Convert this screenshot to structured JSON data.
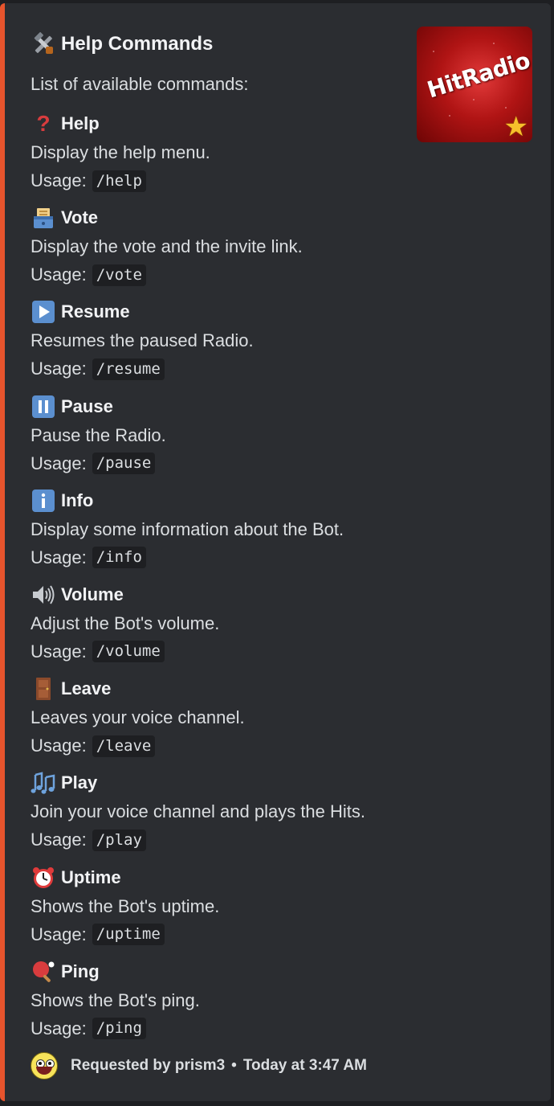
{
  "embed": {
    "accent_color": "#e7542d",
    "title_icon": "hammer-and-wrench-icon",
    "title": "Help Commands",
    "description": "List of available commands:",
    "thumbnail": {
      "text": "HitRadio",
      "icon": "star-icon"
    },
    "usage_label": "Usage:",
    "fields": [
      {
        "icon": "question-mark-icon",
        "name": "Help",
        "description": "Display the help menu.",
        "command": "/help"
      },
      {
        "icon": "ballot-box-icon",
        "name": "Vote",
        "description": "Display the vote and the invite link.",
        "command": "/vote"
      },
      {
        "icon": "play-button-icon",
        "name": "Resume",
        "description": "Resumes the paused Radio.",
        "command": "/resume"
      },
      {
        "icon": "pause-button-icon",
        "name": "Pause",
        "description": "Pause the Radio.",
        "command": "/pause"
      },
      {
        "icon": "information-icon",
        "name": "Info",
        "description": "Display some information about the Bot.",
        "command": "/info"
      },
      {
        "icon": "speaker-high-volume-icon",
        "name": "Volume",
        "description": "Adjust the Bot's volume.",
        "command": "/volume"
      },
      {
        "icon": "door-icon",
        "name": "Leave",
        "description": "Leaves your voice channel.",
        "command": "/leave"
      },
      {
        "icon": "musical-notes-icon",
        "name": "Play",
        "description": "Join your voice channel and plays the Hits.",
        "command": "/play"
      },
      {
        "icon": "alarm-clock-icon",
        "name": "Uptime",
        "description": "Shows the Bot's uptime.",
        "command": "/uptime"
      },
      {
        "icon": "ping-pong-icon",
        "name": "Ping",
        "description": "Shows the Bot's ping.",
        "command": "/ping"
      }
    ],
    "footer": {
      "avatar_icon": "awesome-face-avatar",
      "requested_by": "Requested by prism3",
      "separator": "•",
      "timestamp": "Today at 3:47 AM"
    }
  }
}
